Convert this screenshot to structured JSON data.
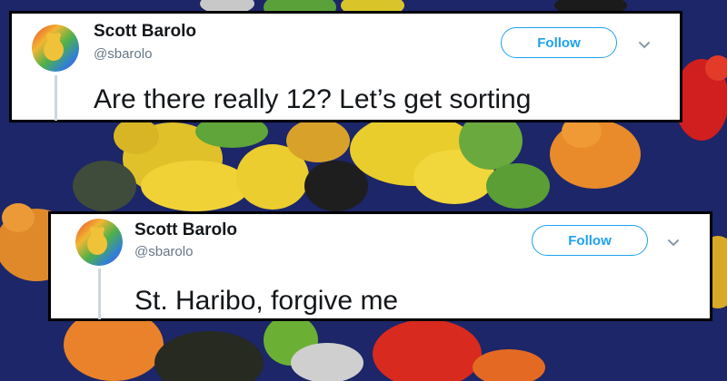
{
  "tweets": [
    {
      "name": "Scott Barolo",
      "handle": "@sbarolo",
      "follow_label": "Follow",
      "text": "Are there really 12? Let’s get sorting"
    },
    {
      "name": "Scott Barolo",
      "handle": "@sbarolo",
      "follow_label": "Follow",
      "text": "St. Haribo, forgive me"
    }
  ],
  "colors": {
    "background_blue": "#1c2668",
    "accent": "#1da1f2",
    "text": "#14171a",
    "muted": "#657786",
    "border": "#000000"
  },
  "icons": [
    "gummy-bear-avatar-icon",
    "chevron-down-icon"
  ]
}
